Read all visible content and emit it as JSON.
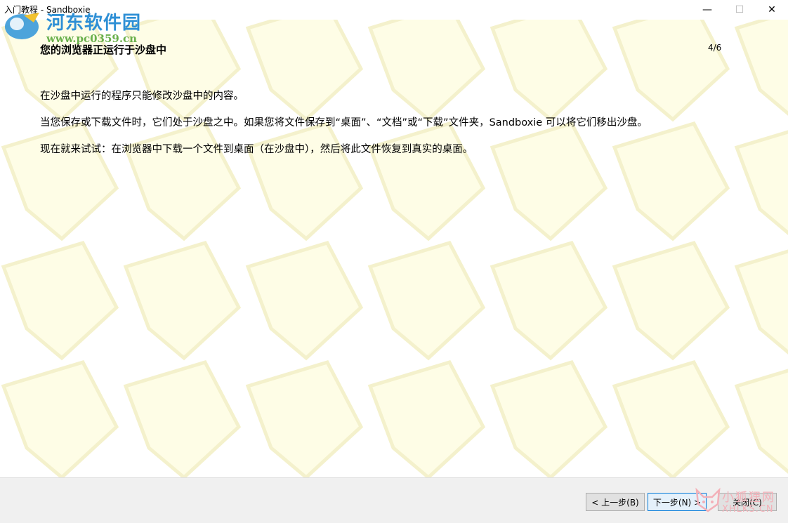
{
  "window": {
    "title": "入门教程 - Sandboxie",
    "minimize_glyph": "—",
    "maximize_glyph": "☐",
    "close_glyph": "✕"
  },
  "page": {
    "heading": "您的浏览器正运行于沙盘中",
    "page_indicator": "4/6",
    "paragraphs": [
      "在沙盘中运行的程序只能修改沙盘中的内容。",
      "当您保存或下载文件时，它们处于沙盘之中。如果您将文件保存到“桌面”、“文档”或“下载”文件夹，Sandboxie 可以将它们移出沙盘。",
      "现在就来试试：在浏览器中下载一个文件到桌面（在沙盘中），然后将此文件恢复到真实的桌面。"
    ]
  },
  "footer": {
    "back_label": "< 上一步(B)",
    "next_label": "下一步(N) >",
    "close_label": "关闭(C)"
  },
  "watermarks": {
    "site_name": "河东软件园",
    "site_url": "www.pc0359.cn",
    "corner_name": "小狐狸网",
    "corner_url": "XHLKS.CN"
  },
  "colors": {
    "background_shape": "#fefde6",
    "background_shape_edge": "#f4f1cc",
    "footer_bg": "#f0f0f0",
    "accent": "#0078d7"
  }
}
